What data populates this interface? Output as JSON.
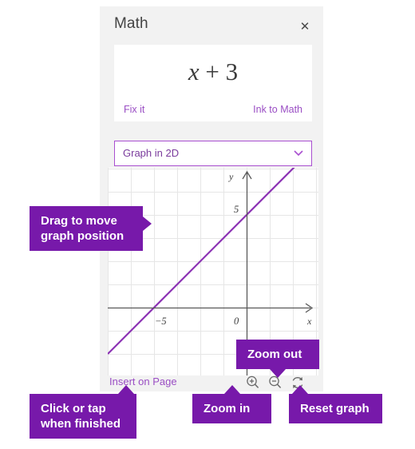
{
  "panel": {
    "title": "Math",
    "close_icon": "close-icon"
  },
  "expression": {
    "variable": "x",
    "rest": " + 3",
    "full": "x + 3",
    "fix_it_label": "Fix it",
    "ink_to_math_label": "Ink to Math"
  },
  "graph_mode": {
    "selected": "Graph in 2D",
    "chevron_icon": "chevron-down-icon"
  },
  "bottom_bar": {
    "insert_label": "Insert on Page",
    "zoom_in_icon": "zoom-in-icon",
    "zoom_out_icon": "zoom-out-icon",
    "reset_icon": "reset-icon"
  },
  "callouts": {
    "drag": "Drag to move\ngraph position",
    "zoom_out": "Zoom out",
    "click_finished": "Click or tap\nwhen finished",
    "zoom_in": "Zoom in",
    "reset_graph": "Reset graph"
  },
  "colors": {
    "callout_purple": "#7719aa",
    "link_purple": "#9a4ec4",
    "plot_line_purple": "#8c32b4",
    "dropdown_border": "#a94fd0",
    "pane_background": "#f2f2f2",
    "grid_line": "#e3e3e3",
    "axis": "#595959"
  },
  "chart_data": {
    "type": "line",
    "title": "",
    "expression": "y = x + 3",
    "slope": 1,
    "intercept": 3,
    "xlabel": "x",
    "ylabel": "y",
    "xlim": [
      -9.2,
      5.2
    ],
    "ylim": [
      -6.2,
      8.2
    ],
    "grid": true,
    "grid_step": 1,
    "x_ticks": [
      -5
    ],
    "x_tick_labels": [
      "-5"
    ],
    "y_ticks": [
      5
    ],
    "y_tick_labels": [
      "5"
    ],
    "origin_label": "0",
    "x_intercept": -3,
    "y_intercept": 3,
    "series": [
      {
        "name": "x + 3",
        "color": "#8c32b4",
        "points": [
          [
            -9.2,
            -6.2
          ],
          [
            5.2,
            8.2
          ]
        ]
      }
    ]
  }
}
